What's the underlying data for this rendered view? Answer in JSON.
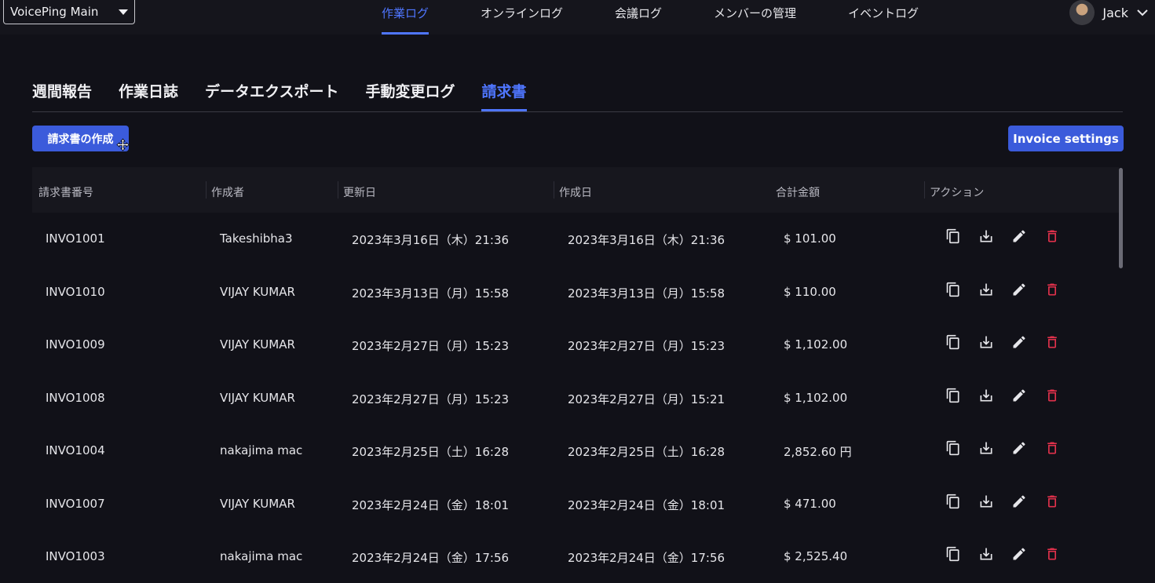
{
  "workspace": {
    "name": "VoicePing Main"
  },
  "nav": {
    "items": [
      "作業ログ",
      "オンラインログ",
      "会議ログ",
      "メンバーの管理",
      "イベントログ"
    ],
    "active_index": 0
  },
  "user": {
    "name": "Jack"
  },
  "tabs": {
    "items": [
      "週間報告",
      "作業日誌",
      "データエクスポート",
      "手動変更ログ",
      "請求書"
    ],
    "active_index": 4
  },
  "buttons": {
    "create_invoice": "請求書の作成",
    "invoice_settings": "Invoice settings"
  },
  "table": {
    "headers": [
      "請求書番号",
      "作成者",
      "更新日",
      "作成日",
      "合計金額",
      "アクション"
    ],
    "rows": [
      {
        "number": "INVO1001",
        "author": "Takeshibha3",
        "updated": "2023年3月16日（木）21:36",
        "created": "2023年3月16日（木）21:36",
        "total": "$ 101.00"
      },
      {
        "number": "INVO1010",
        "author": "VIJAY KUMAR",
        "updated": "2023年3月13日（月）15:58",
        "created": "2023年3月13日（月）15:58",
        "total": "$ 110.00"
      },
      {
        "number": "INVO1009",
        "author": "VIJAY KUMAR",
        "updated": "2023年2月27日（月）15:23",
        "created": "2023年2月27日（月）15:23",
        "total": "$ 1,102.00"
      },
      {
        "number": "INVO1008",
        "author": "VIJAY KUMAR",
        "updated": "2023年2月27日（月）15:23",
        "created": "2023年2月27日（月）15:21",
        "total": "$ 1,102.00"
      },
      {
        "number": "INVO1004",
        "author": "nakajima mac",
        "updated": "2023年2月25日（土）16:28",
        "created": "2023年2月25日（土）16:28",
        "total": "2,852.60 円"
      },
      {
        "number": "INVO1007",
        "author": "VIJAY KUMAR",
        "updated": "2023年2月24日（金）18:01",
        "created": "2023年2月24日（金）18:01",
        "total": "$ 471.00"
      },
      {
        "number": "INVO1003",
        "author": "nakajima mac",
        "updated": "2023年2月24日（金）17:56",
        "created": "2023年2月24日（金）17:56",
        "total": "$ 2,525.40"
      }
    ]
  },
  "icons": {
    "copy": "copy-icon",
    "download": "download-icon",
    "edit": "edit-icon",
    "delete": "delete-icon"
  },
  "colors": {
    "accent": "#4f76ff",
    "primary_button": "#3b5bdb",
    "danger": "#e0314b",
    "background": "#111118"
  }
}
